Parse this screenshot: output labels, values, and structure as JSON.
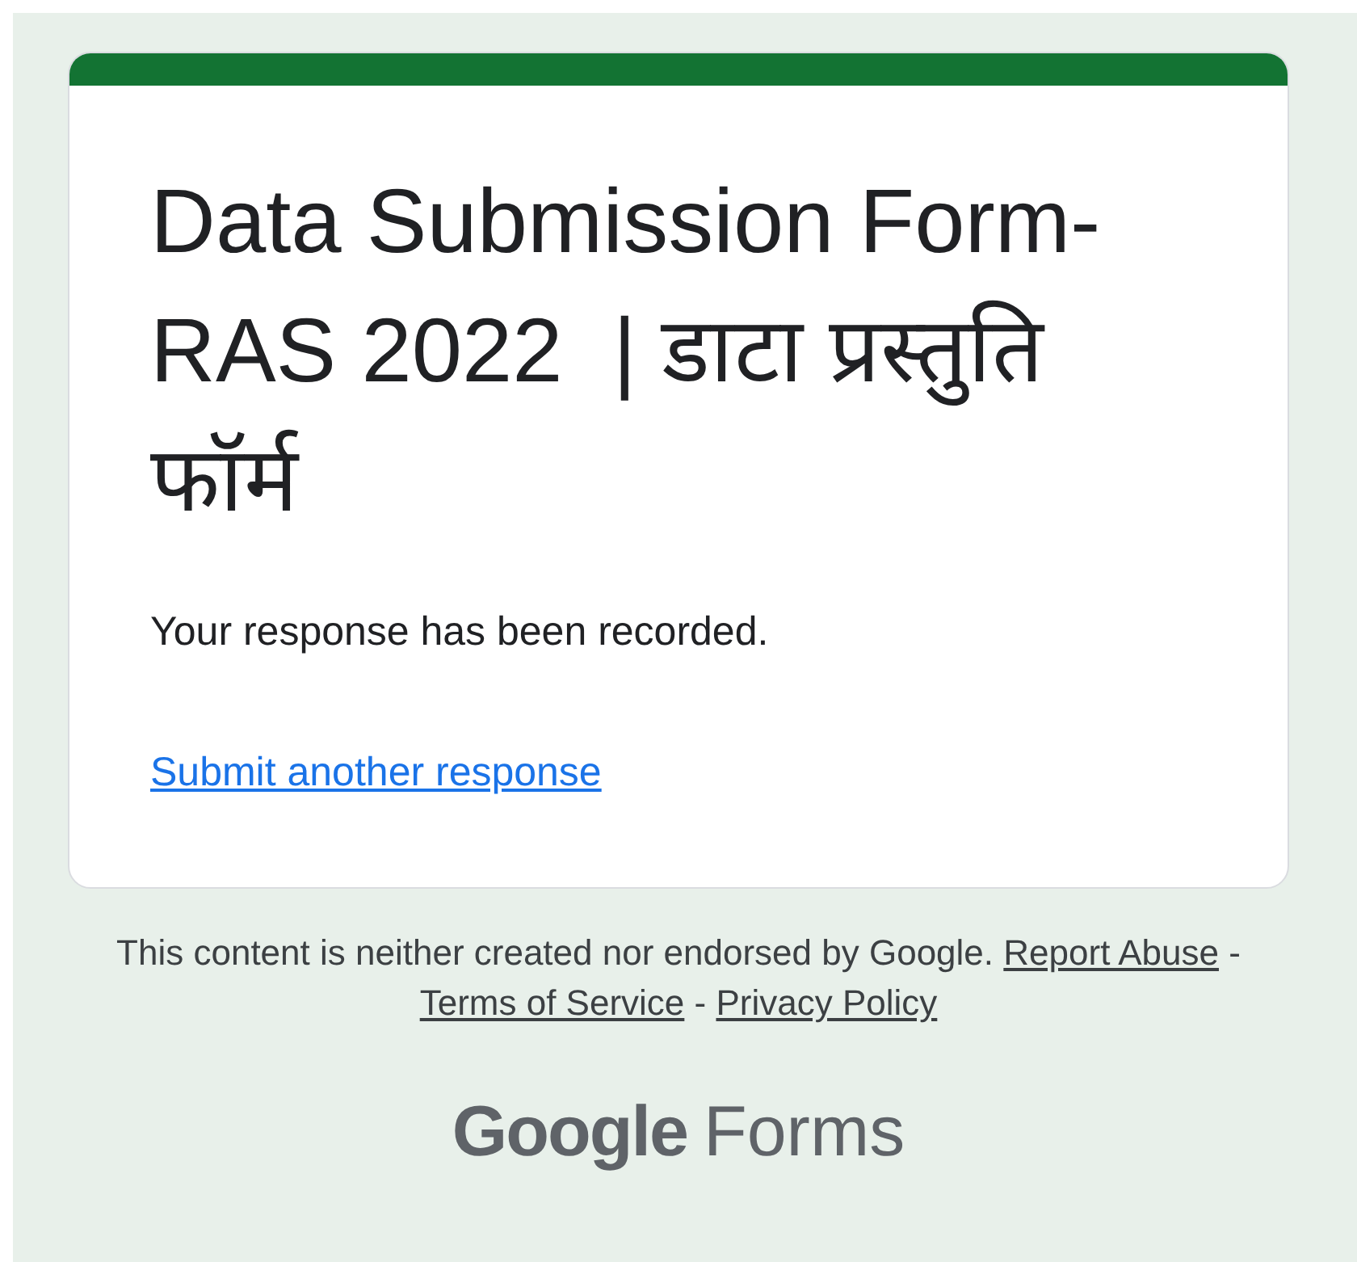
{
  "form": {
    "title": "Data Submission Form- RAS 2022  | डाटा प्रस्तुति फॉर्म",
    "message": "Your response has been recorded.",
    "link": "Submit another response"
  },
  "footer": {
    "disclaimer": "This content is neither created nor endorsed by Google.",
    "links": [
      "Report Abuse",
      "Terms of Service",
      "Privacy Policy"
    ],
    "separator": "-"
  },
  "logo": {
    "brand": "Google",
    "product": "Forms"
  }
}
